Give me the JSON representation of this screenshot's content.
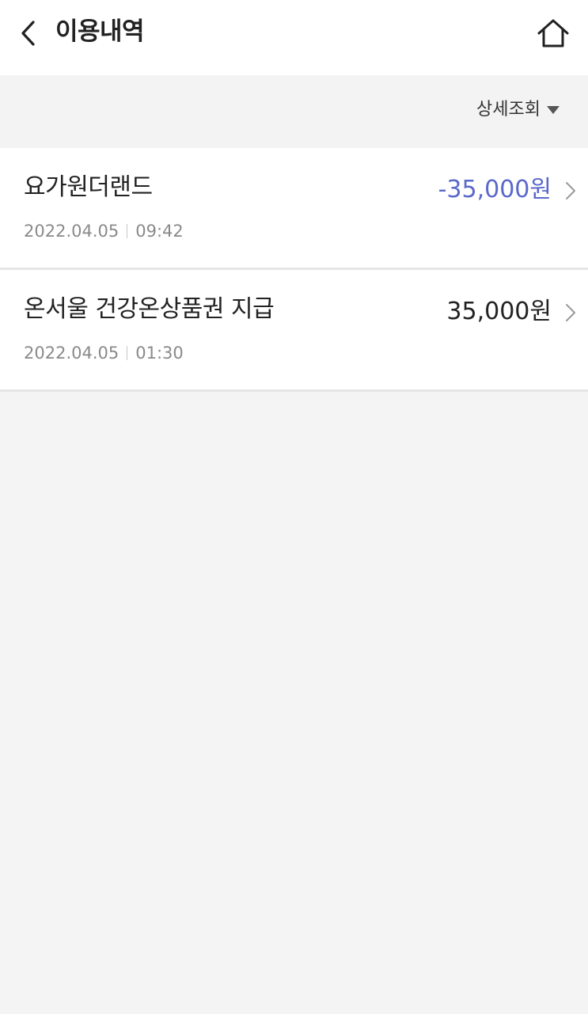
{
  "header": {
    "title": "이용내역",
    "back_icon": "chevron-left-icon",
    "home_icon": "home-icon"
  },
  "filter": {
    "label": "상세조회",
    "icon": "caret-down-icon"
  },
  "transactions": [
    {
      "title": "요가원더랜드",
      "date": "2022.04.05",
      "time": "09:42",
      "amount": "-35,000원",
      "amount_color": "#5a68c9"
    },
    {
      "title": "온서울 건강온상품권 지급",
      "date": "2022.04.05",
      "time": "01:30",
      "amount": "35,000원",
      "amount_color": "#222222"
    }
  ],
  "colors": {
    "background": "#f4f4f4",
    "surface": "#ffffff",
    "divider": "#e6e6e6",
    "meta_text": "#8a8a8a",
    "negative_amount": "#5a68c9"
  }
}
